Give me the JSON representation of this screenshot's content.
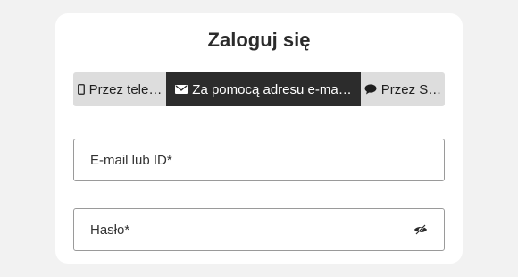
{
  "login": {
    "title": "Zaloguj się",
    "tabs": [
      {
        "label": "Przez tele…",
        "icon": "phone-icon",
        "selected": false
      },
      {
        "label": "Za pomocą adresu e-ma…",
        "icon": "envelope-icon",
        "selected": true
      },
      {
        "label": "Przez S…",
        "icon": "chat-bubble-icon",
        "selected": false
      }
    ],
    "email_field": {
      "placeholder": "E-mail lub ID*",
      "value": ""
    },
    "password_field": {
      "placeholder": "Hasło*",
      "value": "",
      "toggle_icon": "eye-slash-icon"
    }
  },
  "colors": {
    "page_bg": "#f2f2f2",
    "card_bg": "#ffffff",
    "tab_bg": "#dddddd",
    "tab_selected_bg": "#2c2c2c"
  }
}
